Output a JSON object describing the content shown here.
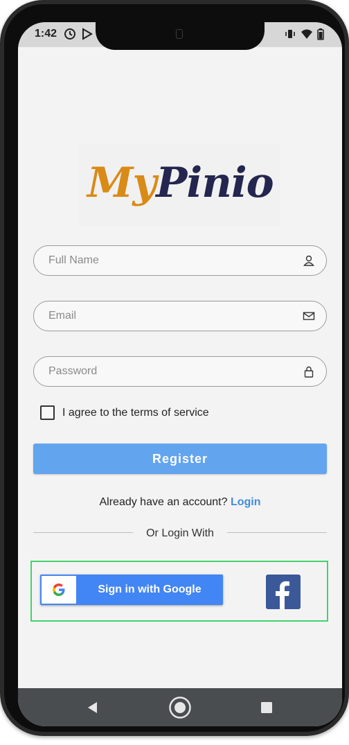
{
  "status_bar": {
    "time": "1:42",
    "left_icons": [
      "alarm-icon",
      "play-store-icon"
    ],
    "right_icons": [
      "vibrate-icon",
      "wifi-icon",
      "battery-icon"
    ]
  },
  "logo": {
    "part1": "My",
    "part2": "Pinio",
    "colors": {
      "part1": "#d98b17",
      "part2": "#24264f"
    }
  },
  "form": {
    "full_name": {
      "placeholder": "Full Name",
      "icon": "person-icon"
    },
    "email": {
      "placeholder": "Email",
      "icon": "mail-icon"
    },
    "password": {
      "placeholder": "Password",
      "icon": "lock-icon"
    },
    "terms_label": "I agree to the terms of service",
    "terms_checked": false,
    "register_label": "Register"
  },
  "login_prompt": {
    "text": "Already have an account? ",
    "link": "Login"
  },
  "divider_text": "Or Login With",
  "social": {
    "google_label": "Sign in with Google",
    "facebook_icon": "facebook-icon"
  },
  "nav": {
    "icons": [
      "back-icon",
      "home-icon",
      "recents-icon"
    ]
  },
  "colors": {
    "primary": "#63a4ef",
    "google": "#4285f4",
    "facebook": "#3b5998",
    "highlight": "#41d36c",
    "link": "#3f8ddc"
  }
}
